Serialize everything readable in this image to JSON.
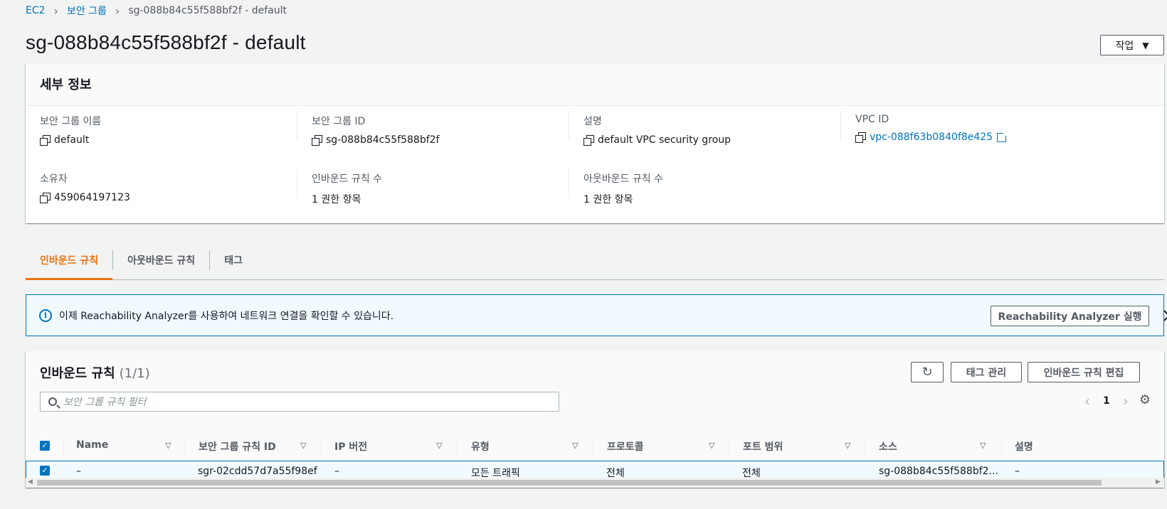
{
  "breadcrumb": {
    "root": "EC2",
    "parent": "보안 그룹",
    "current": "sg-088b84c55f588bf2f - default"
  },
  "title": "sg-088b84c55f588bf2f - default",
  "actions_label": "작업",
  "details": {
    "heading": "세부 정보",
    "fields": {
      "sg_name": {
        "label": "보안 그룹 이름",
        "value": "default"
      },
      "sg_id": {
        "label": "보안 그룹 ID",
        "value": "sg-088b84c55f588bf2f"
      },
      "description": {
        "label": "설명",
        "value": "default VPC security group"
      },
      "vpc_id": {
        "label": "VPC ID",
        "value": "vpc-088f63b0840f8e425"
      },
      "owner": {
        "label": "소유자",
        "value": "459064197123"
      },
      "inbound_count": {
        "label": "인바운드 규칙 수",
        "value": "1 권한 항목"
      },
      "outbound_count": {
        "label": "아웃바운드 규칙 수",
        "value": "1 권한 항목"
      }
    }
  },
  "tabs": [
    "인바운드 규칙",
    "아웃바운드 규칙",
    "태그"
  ],
  "banner": {
    "message": "이제 Reachability Analyzer를 사용하여 네트워크 연결을 확인할 수 있습니다.",
    "button": "Reachability Analyzer 실행"
  },
  "rules": {
    "title": "인바운드 규칙",
    "count": "(1/1)",
    "tag_button": "태그 관리",
    "edit_button": "인바운드 규칙 편집",
    "search_placeholder": "보안 그룹 규칙 필터",
    "page": "1",
    "columns": [
      "Name",
      "보안 그룹 규칙 ID",
      "IP 버전",
      "유형",
      "프로토콜",
      "포트 범위",
      "소스",
      "설명"
    ],
    "row": {
      "name": "–",
      "rule_id": "sgr-02cdd57d7a55f98ef",
      "ip_version": "–",
      "type": "모든 트래픽",
      "protocol": "전체",
      "port_range": "전체",
      "source": "sg-088b84c55f588bf2...",
      "description": "–"
    }
  },
  "colors": {
    "link": "#0073bb",
    "accent": "#ec7211",
    "info_bg": "#f1faff"
  }
}
